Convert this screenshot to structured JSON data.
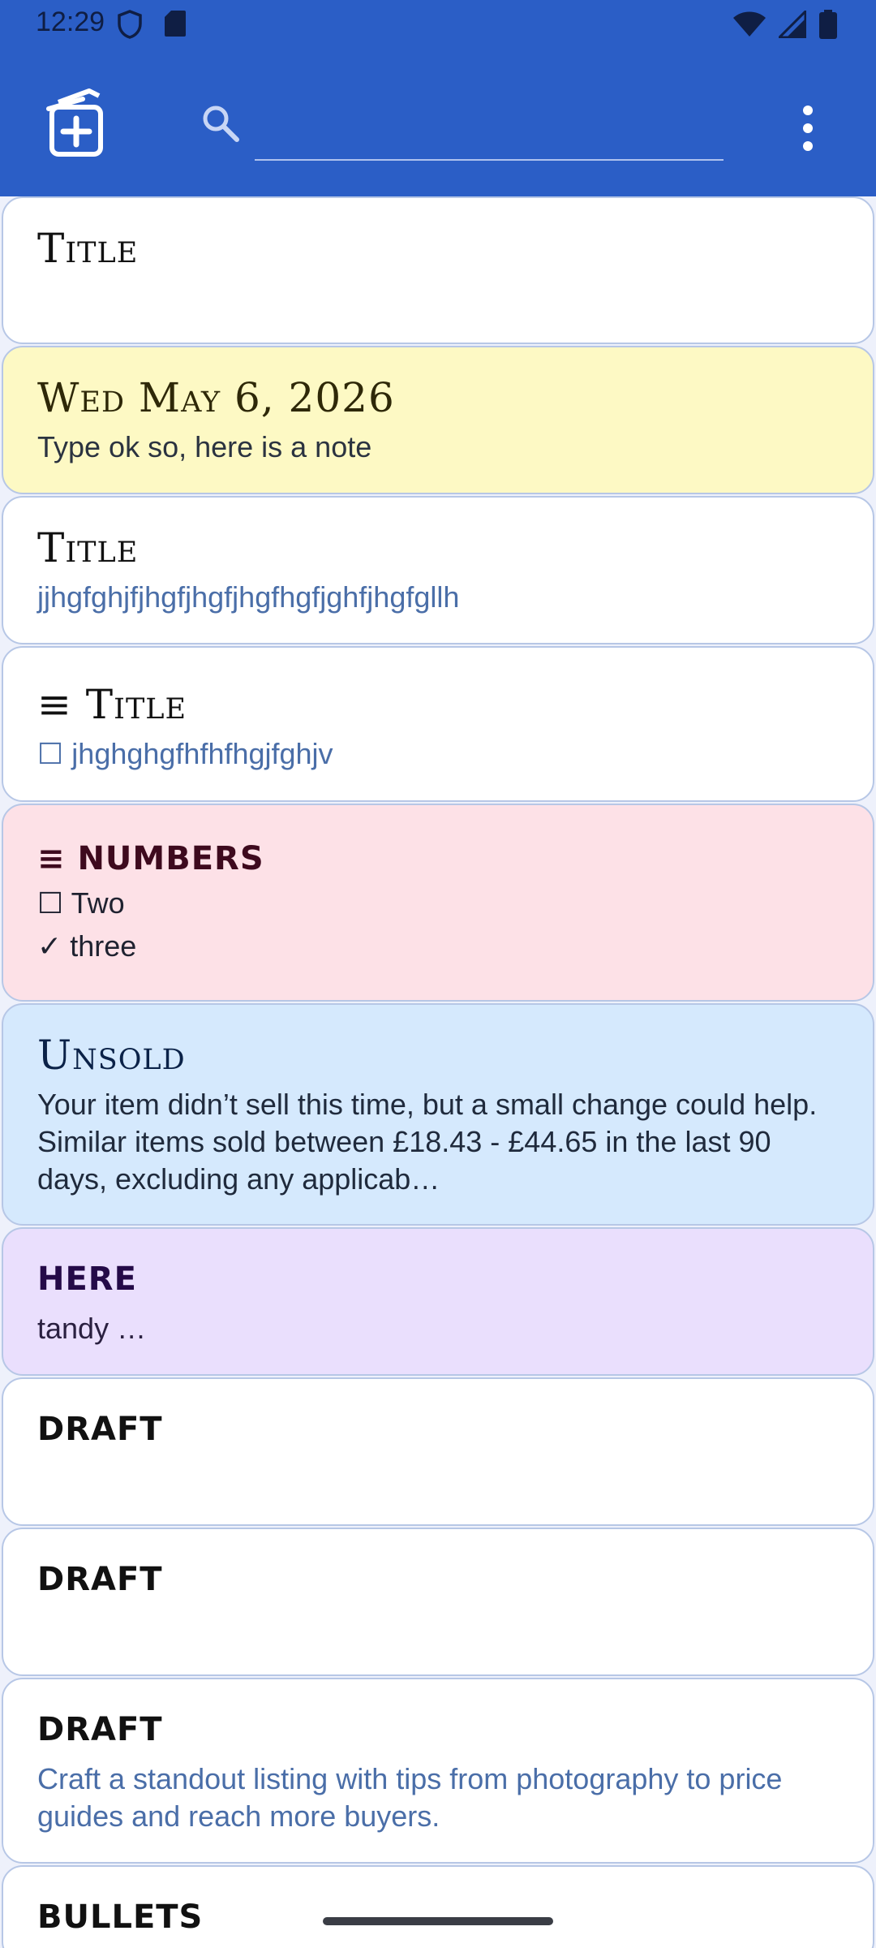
{
  "status_bar": {
    "time": "12:29",
    "left_icons": [
      "shield-icon",
      "sim-card-icon"
    ],
    "right_icons": [
      "wifi-icon",
      "signal-icon",
      "battery-icon"
    ]
  },
  "app_bar": {
    "new_note_icon": "add-note-icon",
    "search_icon": "search-icon",
    "search_value": "",
    "overflow_icon": "more-vert-icon",
    "color": "#2b5ec6"
  },
  "notes": [
    {
      "title": "Title",
      "body": "",
      "color": "#ffffff"
    },
    {
      "title": "Wed May 6, 2026",
      "body": "Type ok so, here is a note",
      "color": "#fdf9c4"
    },
    {
      "title": "Title",
      "body": "jjhgfghjfjhgfjhgfjhgfhgfjghfjhgfgllh",
      "color": "#ffffff"
    },
    {
      "title": "≡ Title",
      "items": [
        {
          "mark": "☐",
          "text": "jhghghgfhfhfhgjfghjv"
        }
      ],
      "color": "#ffffff"
    },
    {
      "title": "≡ NUMBERS",
      "items": [
        {
          "mark": "☐",
          "text": "Two"
        },
        {
          "mark": "✓",
          "text": "three"
        }
      ],
      "color": "#fde1e7"
    },
    {
      "title": "Unsold",
      "body": "Your item didn’t sell this time, but a small change could help. Similar items sold between £18.43 - £44.65 in the last 90 days, excluding any applicab…",
      "color": "#d5e9fd"
    },
    {
      "title": "HERE",
      "body": "tandy …",
      "color": "#eadffd"
    },
    {
      "title": "DRAFT",
      "body": "",
      "color": "#ffffff"
    },
    {
      "title": "DRAFT",
      "body": "",
      "color": "#ffffff"
    },
    {
      "title": "DRAFT",
      "body": "Craft a standout listing with tips from photography to price guides and reach more buyers.",
      "color": "#ffffff"
    },
    {
      "title": "BULLETS",
      "body": "",
      "color": "#ffffff"
    }
  ]
}
